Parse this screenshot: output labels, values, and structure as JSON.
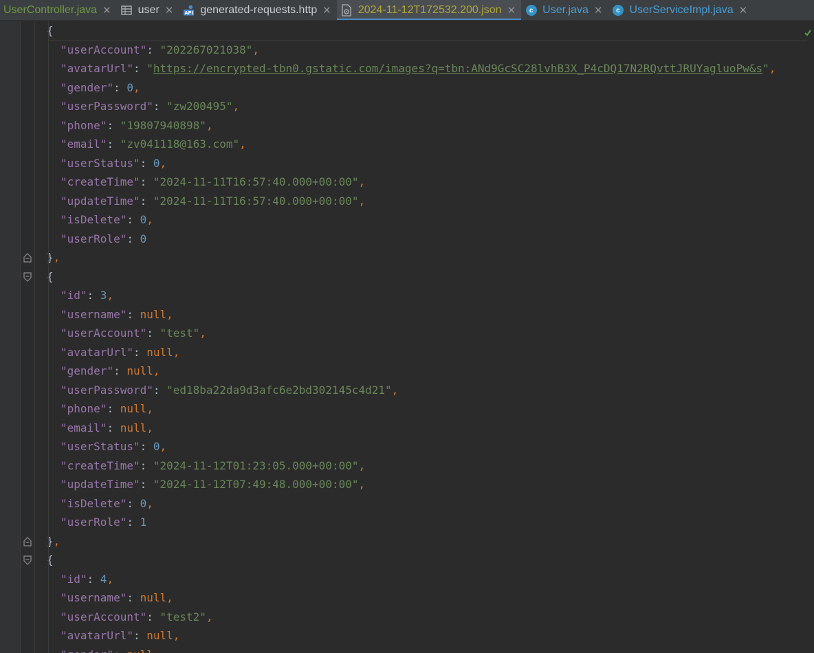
{
  "tabs": [
    {
      "label": "UserController.java",
      "icon": "none",
      "color": "#6f9a45"
    },
    {
      "label": "user",
      "icon": "table-icon",
      "color": "#c9cdd2"
    },
    {
      "label": "generated-requests.http",
      "icon": "api-icon",
      "color": "#c9cdd2"
    },
    {
      "label": "2024-11-12T172532.200.json",
      "icon": "json-file-icon",
      "color": "#b0a63a",
      "active": true
    },
    {
      "label": "User.java",
      "icon": "class-icon",
      "color": "#4a9fd8"
    },
    {
      "label": "UserServiceImpl.java",
      "icon": "class-icon",
      "color": "#4a9fd8"
    }
  ],
  "editor": {
    "lines": [
      {
        "indent": 1,
        "tokens": [
          [
            "p",
            "{"
          ]
        ]
      },
      {
        "indent": 2,
        "tokens": [
          [
            "k",
            "\"userAccount\""
          ],
          [
            "p",
            ": "
          ],
          [
            "s",
            "\"202267021038\""
          ],
          [
            "kw",
            ","
          ]
        ]
      },
      {
        "indent": 2,
        "tokens": [
          [
            "k",
            "\"avatarUrl\""
          ],
          [
            "p",
            ": "
          ],
          [
            "s",
            "\""
          ],
          [
            "url",
            "https://encrypted-tbn0.gstatic.com/images?q=tbn:ANd9GcSC28lvhB3X_P4cDQ17N2RQvttJRUYagluoPw&s"
          ],
          [
            "s",
            "\""
          ],
          [
            "kw",
            ","
          ]
        ]
      },
      {
        "indent": 2,
        "tokens": [
          [
            "k",
            "\"gender\""
          ],
          [
            "p",
            ": "
          ],
          [
            "n",
            "0"
          ],
          [
            "kw",
            ","
          ]
        ]
      },
      {
        "indent": 2,
        "tokens": [
          [
            "k",
            "\"userPassword\""
          ],
          [
            "p",
            ": "
          ],
          [
            "s",
            "\"zw200495\""
          ],
          [
            "kw",
            ","
          ]
        ]
      },
      {
        "indent": 2,
        "tokens": [
          [
            "k",
            "\"phone\""
          ],
          [
            "p",
            ": "
          ],
          [
            "s",
            "\"19807940898\""
          ],
          [
            "kw",
            ","
          ]
        ]
      },
      {
        "indent": 2,
        "tokens": [
          [
            "k",
            "\"email\""
          ],
          [
            "p",
            ": "
          ],
          [
            "s",
            "\"zv041118@163.com\""
          ],
          [
            "kw",
            ","
          ]
        ]
      },
      {
        "indent": 2,
        "tokens": [
          [
            "k",
            "\"userStatus\""
          ],
          [
            "p",
            ": "
          ],
          [
            "n",
            "0"
          ],
          [
            "kw",
            ","
          ]
        ]
      },
      {
        "indent": 2,
        "tokens": [
          [
            "k",
            "\"createTime\""
          ],
          [
            "p",
            ": "
          ],
          [
            "s",
            "\"2024-11-11T16:57:40.000+00:00\""
          ],
          [
            "kw",
            ","
          ]
        ]
      },
      {
        "indent": 2,
        "tokens": [
          [
            "k",
            "\"updateTime\""
          ],
          [
            "p",
            ": "
          ],
          [
            "s",
            "\"2024-11-11T16:57:40.000+00:00\""
          ],
          [
            "kw",
            ","
          ]
        ]
      },
      {
        "indent": 2,
        "tokens": [
          [
            "k",
            "\"isDelete\""
          ],
          [
            "p",
            ": "
          ],
          [
            "n",
            "0"
          ],
          [
            "kw",
            ","
          ]
        ]
      },
      {
        "indent": 2,
        "tokens": [
          [
            "k",
            "\"userRole\""
          ],
          [
            "p",
            ": "
          ],
          [
            "n",
            "0"
          ]
        ]
      },
      {
        "indent": 1,
        "tokens": [
          [
            "p",
            "}"
          ],
          [
            "kw",
            ","
          ]
        ],
        "fold": "end"
      },
      {
        "indent": 1,
        "tokens": [
          [
            "p",
            "{"
          ]
        ],
        "fold": "start"
      },
      {
        "indent": 2,
        "tokens": [
          [
            "k",
            "\"id\""
          ],
          [
            "p",
            ": "
          ],
          [
            "n",
            "3"
          ],
          [
            "kw",
            ","
          ]
        ]
      },
      {
        "indent": 2,
        "tokens": [
          [
            "k",
            "\"username\""
          ],
          [
            "p",
            ": "
          ],
          [
            "kw",
            "null"
          ],
          [
            "kw",
            ","
          ]
        ]
      },
      {
        "indent": 2,
        "tokens": [
          [
            "k",
            "\"userAccount\""
          ],
          [
            "p",
            ": "
          ],
          [
            "s",
            "\"test\""
          ],
          [
            "kw",
            ","
          ]
        ]
      },
      {
        "indent": 2,
        "tokens": [
          [
            "k",
            "\"avatarUrl\""
          ],
          [
            "p",
            ": "
          ],
          [
            "kw",
            "null"
          ],
          [
            "kw",
            ","
          ]
        ]
      },
      {
        "indent": 2,
        "tokens": [
          [
            "k",
            "\"gender\""
          ],
          [
            "p",
            ": "
          ],
          [
            "kw",
            "null"
          ],
          [
            "kw",
            ","
          ]
        ]
      },
      {
        "indent": 2,
        "tokens": [
          [
            "k",
            "\"userPassword\""
          ],
          [
            "p",
            ": "
          ],
          [
            "s",
            "\"ed18ba22da9d3afc6e2bd302145c4d21\""
          ],
          [
            "kw",
            ","
          ]
        ]
      },
      {
        "indent": 2,
        "tokens": [
          [
            "k",
            "\"phone\""
          ],
          [
            "p",
            ": "
          ],
          [
            "kw",
            "null"
          ],
          [
            "kw",
            ","
          ]
        ]
      },
      {
        "indent": 2,
        "tokens": [
          [
            "k",
            "\"email\""
          ],
          [
            "p",
            ": "
          ],
          [
            "kw",
            "null"
          ],
          [
            "kw",
            ","
          ]
        ]
      },
      {
        "indent": 2,
        "tokens": [
          [
            "k",
            "\"userStatus\""
          ],
          [
            "p",
            ": "
          ],
          [
            "n",
            "0"
          ],
          [
            "kw",
            ","
          ]
        ]
      },
      {
        "indent": 2,
        "tokens": [
          [
            "k",
            "\"createTime\""
          ],
          [
            "p",
            ": "
          ],
          [
            "s",
            "\"2024-11-12T01:23:05.000+00:00\""
          ],
          [
            "kw",
            ","
          ]
        ]
      },
      {
        "indent": 2,
        "tokens": [
          [
            "k",
            "\"updateTime\""
          ],
          [
            "p",
            ": "
          ],
          [
            "s",
            "\"2024-11-12T07:49:48.000+00:00\""
          ],
          [
            "kw",
            ","
          ]
        ]
      },
      {
        "indent": 2,
        "tokens": [
          [
            "k",
            "\"isDelete\""
          ],
          [
            "p",
            ": "
          ],
          [
            "n",
            "0"
          ],
          [
            "kw",
            ","
          ]
        ]
      },
      {
        "indent": 2,
        "tokens": [
          [
            "k",
            "\"userRole\""
          ],
          [
            "p",
            ": "
          ],
          [
            "n",
            "1"
          ]
        ]
      },
      {
        "indent": 1,
        "tokens": [
          [
            "p",
            "}"
          ],
          [
            "kw",
            ","
          ]
        ],
        "fold": "end"
      },
      {
        "indent": 1,
        "tokens": [
          [
            "p",
            "{"
          ]
        ],
        "fold": "start"
      },
      {
        "indent": 2,
        "tokens": [
          [
            "k",
            "\"id\""
          ],
          [
            "p",
            ": "
          ],
          [
            "n",
            "4"
          ],
          [
            "kw",
            ","
          ]
        ]
      },
      {
        "indent": 2,
        "tokens": [
          [
            "k",
            "\"username\""
          ],
          [
            "p",
            ": "
          ],
          [
            "kw",
            "null"
          ],
          [
            "kw",
            ","
          ]
        ]
      },
      {
        "indent": 2,
        "tokens": [
          [
            "k",
            "\"userAccount\""
          ],
          [
            "p",
            ": "
          ],
          [
            "s",
            "\"test2\""
          ],
          [
            "kw",
            ","
          ]
        ]
      },
      {
        "indent": 2,
        "tokens": [
          [
            "k",
            "\"avatarUrl\""
          ],
          [
            "p",
            ": "
          ],
          [
            "kw",
            "null"
          ],
          [
            "kw",
            ","
          ]
        ]
      },
      {
        "indent": 2,
        "tokens": [
          [
            "k",
            "\"gender\""
          ],
          [
            "p",
            ": "
          ],
          [
            "kw",
            "null"
          ]
        ]
      }
    ]
  },
  "colors": {
    "background": "#2b2b2b",
    "key": "#9876aa",
    "string": "#6a8759",
    "number": "#6897bb",
    "keyword": "#cc7832",
    "active_tab_underline": "#4a88c7"
  }
}
